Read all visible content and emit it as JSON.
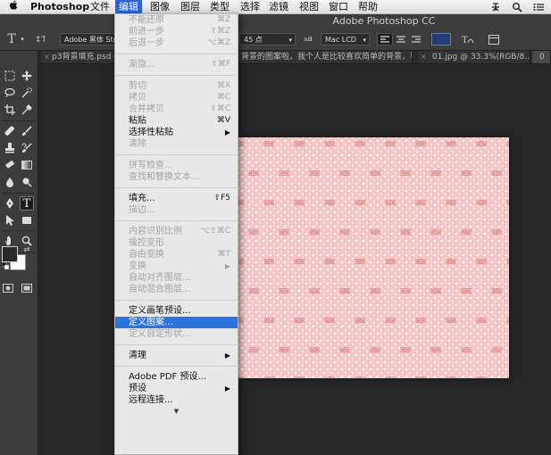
{
  "menubar": {
    "app_name": "Photoshop",
    "items": [
      "文件",
      "编辑",
      "图像",
      "图层",
      "类型",
      "选择",
      "滤镜",
      "视图",
      "窗口",
      "帮助"
    ],
    "active_item": "编辑"
  },
  "window": {
    "title": "Adobe Photoshop CC"
  },
  "options_bar": {
    "font_family": "Adobe 黑体 Std",
    "font_size": "45 点",
    "aa_label": "a",
    "antialias": "Mac LCD",
    "text_color": "#1f3d7a"
  },
  "tabs": [
    {
      "label": "p3背景填充.psd @"
    },
    {
      "label": "背景的图案啦，我个人是比较喜欢简单的背景，毕..."
    },
    {
      "label": "01.jpg @ 33.3%(RGB/8..."
    },
    {
      "label": "0"
    }
  ],
  "canvas": {
    "pattern_glyph": "ꕤ",
    "background": "#f6c6c6",
    "motif_color": "#d98b8b"
  },
  "edit_menu": {
    "items": [
      {
        "label": "不能还原",
        "shortcut": "⌘Z",
        "disabled": true
      },
      {
        "label": "前进一步",
        "shortcut": "⇧⌘Z",
        "disabled": true
      },
      {
        "label": "后退一步",
        "shortcut": "⌥⌘Z",
        "disabled": true
      },
      {
        "sep": true
      },
      {
        "label": "渐隐...",
        "shortcut": "⇧⌘F",
        "disabled": true
      },
      {
        "sep": true
      },
      {
        "label": "剪切",
        "shortcut": "⌘X",
        "disabled": true
      },
      {
        "label": "拷贝",
        "shortcut": "⌘C",
        "disabled": true
      },
      {
        "label": "合并拷贝",
        "shortcut": "⇧⌘C",
        "disabled": true
      },
      {
        "label": "粘贴",
        "shortcut": "⌘V",
        "disabled": false
      },
      {
        "label": "选择性粘贴",
        "submenu": true,
        "disabled": false
      },
      {
        "label": "清除",
        "disabled": true
      },
      {
        "sep": true
      },
      {
        "label": "拼写检查...",
        "disabled": true
      },
      {
        "label": "查找和替换文本...",
        "disabled": true
      },
      {
        "sep": true
      },
      {
        "label": "填充...",
        "shortcut": "⇧F5",
        "disabled": false
      },
      {
        "label": "描边...",
        "disabled": true
      },
      {
        "sep": true
      },
      {
        "label": "内容识别比例",
        "shortcut": "⌥⇧⌘C",
        "disabled": true
      },
      {
        "label": "操控变形",
        "disabled": true
      },
      {
        "label": "自由变换",
        "shortcut": "⌘T",
        "disabled": true
      },
      {
        "label": "变换",
        "submenu": true,
        "disabled": true
      },
      {
        "label": "自动对齐图层...",
        "disabled": true
      },
      {
        "label": "自动混合图层...",
        "disabled": true
      },
      {
        "sep": true
      },
      {
        "label": "定义画笔预设...",
        "disabled": false
      },
      {
        "label": "定义图案...",
        "disabled": false,
        "highlighted": true
      },
      {
        "label": "定义自定形状...",
        "disabled": true
      },
      {
        "sep": true
      },
      {
        "label": "清理",
        "submenu": true,
        "disabled": false
      },
      {
        "sep": true
      },
      {
        "label": "Adobe PDF 预设...",
        "disabled": false
      },
      {
        "label": "预设",
        "submenu": true,
        "disabled": false
      },
      {
        "label": "远程连接...",
        "disabled": false
      }
    ],
    "more_arrow": "▼"
  },
  "icons": {
    "apple": "apple-icon",
    "search": "search-icon",
    "menu": "list-icon",
    "ime": "ime-icon",
    "creative_cloud": "creative-cloud-icon"
  }
}
